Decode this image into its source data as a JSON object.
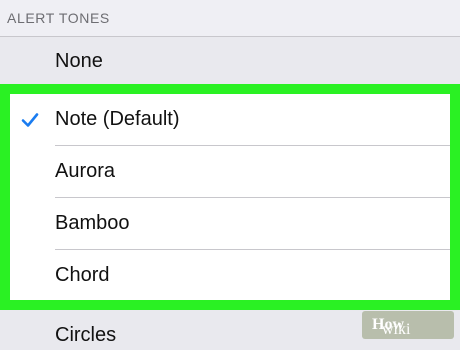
{
  "section": {
    "header": "ALERT TONES"
  },
  "tones": [
    {
      "label": "None",
      "selected": false
    },
    {
      "label": "Note (Default)",
      "selected": true
    },
    {
      "label": "Aurora",
      "selected": false
    },
    {
      "label": "Bamboo",
      "selected": false
    },
    {
      "label": "Chord",
      "selected": false
    },
    {
      "label": "Circles",
      "selected": false
    }
  ],
  "icons": {
    "selected": "checkmark-icon"
  },
  "colors": {
    "highlight": "#2af123",
    "checkmark": "#1a7cf0",
    "background": "#efeff4"
  },
  "watermark": {
    "text_a": "wiki",
    "text_b": "How"
  }
}
